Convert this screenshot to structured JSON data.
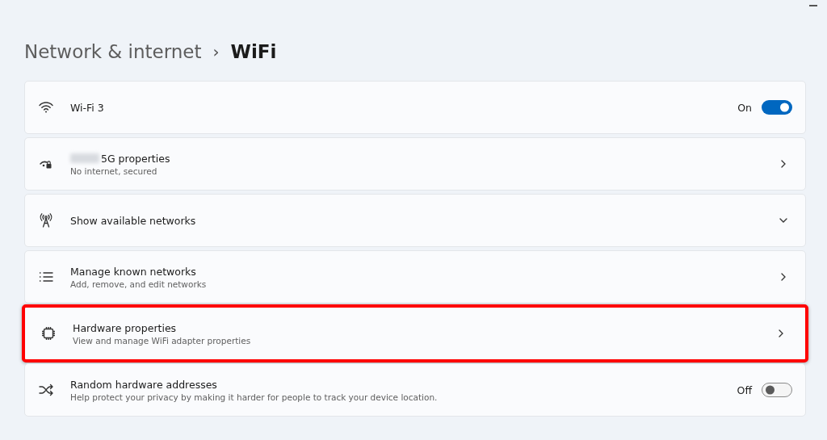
{
  "breadcrumb": {
    "parent": "Network & internet",
    "separator": "›",
    "current": "WiFi"
  },
  "settings": [
    {
      "kind": "toggle",
      "title": "Wi-Fi 3",
      "on": true,
      "state_label": "On",
      "highlighted": false
    },
    {
      "kind": "link",
      "title": "5G properties",
      "redacted_prefix": true,
      "subtitle": "No internet, secured",
      "highlighted": false
    },
    {
      "kind": "expand",
      "title": "Show available networks",
      "highlighted": false
    },
    {
      "kind": "link",
      "title": "Manage known networks",
      "subtitle": "Add, remove, and edit networks",
      "highlighted": false
    },
    {
      "kind": "link",
      "title": "Hardware properties",
      "subtitle": "View and manage WiFi adapter properties",
      "highlighted": true
    },
    {
      "kind": "toggle",
      "title": "Random hardware addresses",
      "subtitle": "Help protect your privacy by making it harder for people to track your device location.",
      "on": false,
      "state_label": "Off",
      "highlighted": false
    }
  ]
}
